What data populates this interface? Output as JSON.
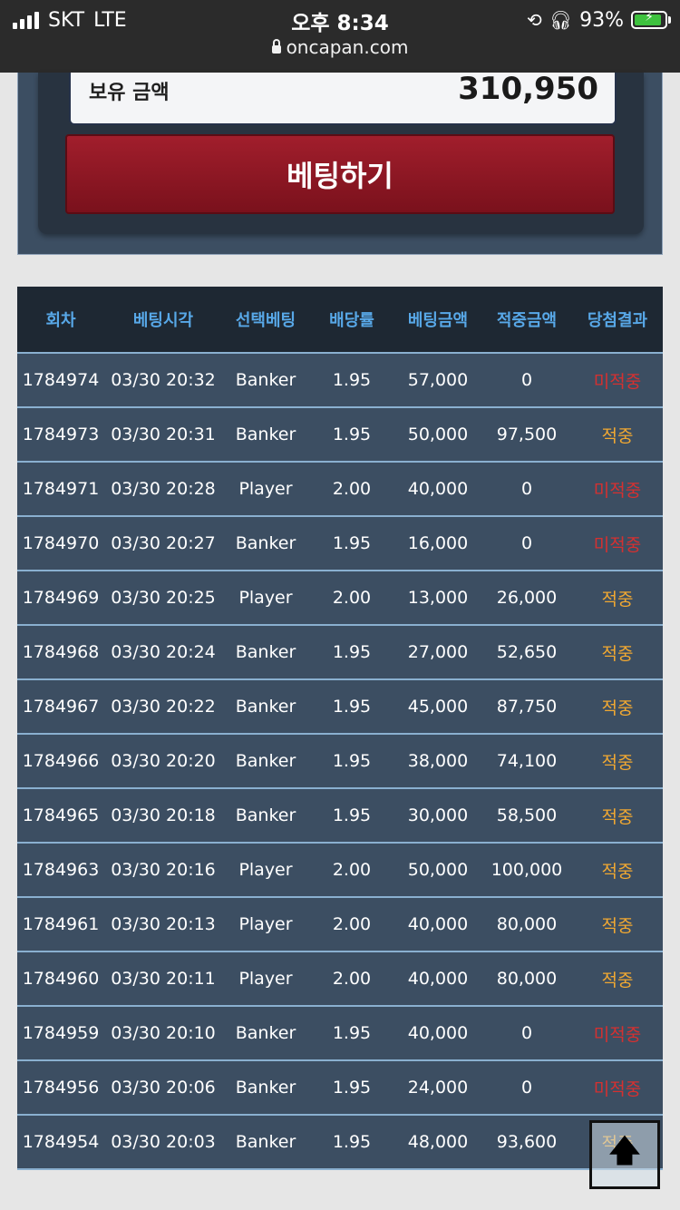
{
  "status_bar": {
    "carrier": "SKT",
    "network": "LTE",
    "time": "오후 8:34",
    "battery": "93%",
    "url": "oncapan.com"
  },
  "balance": {
    "label": "보유 금액",
    "value": "310,950"
  },
  "bet_button": {
    "label": "베팅하기"
  },
  "table": {
    "headers": [
      "회차",
      "베팅시각",
      "선택베팅",
      "배당률",
      "베팅금액",
      "적중금액",
      "당첨결과"
    ],
    "rows": [
      [
        "1784974",
        "03/30 20:32",
        "Banker",
        "1.95",
        "57,000",
        "0",
        "미적중"
      ],
      [
        "1784973",
        "03/30 20:31",
        "Banker",
        "1.95",
        "50,000",
        "97,500",
        "적중"
      ],
      [
        "1784971",
        "03/30 20:28",
        "Player",
        "2.00",
        "40,000",
        "0",
        "미적중"
      ],
      [
        "1784970",
        "03/30 20:27",
        "Banker",
        "1.95",
        "16,000",
        "0",
        "미적중"
      ],
      [
        "1784969",
        "03/30 20:25",
        "Player",
        "2.00",
        "13,000",
        "26,000",
        "적중"
      ],
      [
        "1784968",
        "03/30 20:24",
        "Banker",
        "1.95",
        "27,000",
        "52,650",
        "적중"
      ],
      [
        "1784967",
        "03/30 20:22",
        "Banker",
        "1.95",
        "45,000",
        "87,750",
        "적중"
      ],
      [
        "1784966",
        "03/30 20:20",
        "Banker",
        "1.95",
        "38,000",
        "74,100",
        "적중"
      ],
      [
        "1784965",
        "03/30 20:18",
        "Banker",
        "1.95",
        "30,000",
        "58,500",
        "적중"
      ],
      [
        "1784963",
        "03/30 20:16",
        "Player",
        "2.00",
        "50,000",
        "100,000",
        "적중"
      ],
      [
        "1784961",
        "03/30 20:13",
        "Player",
        "2.00",
        "40,000",
        "80,000",
        "적중"
      ],
      [
        "1784960",
        "03/30 20:11",
        "Player",
        "2.00",
        "40,000",
        "80,000",
        "적중"
      ],
      [
        "1784959",
        "03/30 20:10",
        "Banker",
        "1.95",
        "40,000",
        "0",
        "미적중"
      ],
      [
        "1784956",
        "03/30 20:06",
        "Banker",
        "1.95",
        "24,000",
        "0",
        "미적중"
      ],
      [
        "1784954",
        "03/30 20:03",
        "Banker",
        "1.95",
        "48,000",
        "93,600",
        "적중"
      ]
    ]
  },
  "colors": {
    "header_text": "#58a8e8",
    "hit": "#f0a832",
    "miss": "#d63030",
    "row_bg": "#3c4e62",
    "bet_button": "#8e1723"
  },
  "icons": {
    "scroll_top": "arrow-up-icon"
  }
}
